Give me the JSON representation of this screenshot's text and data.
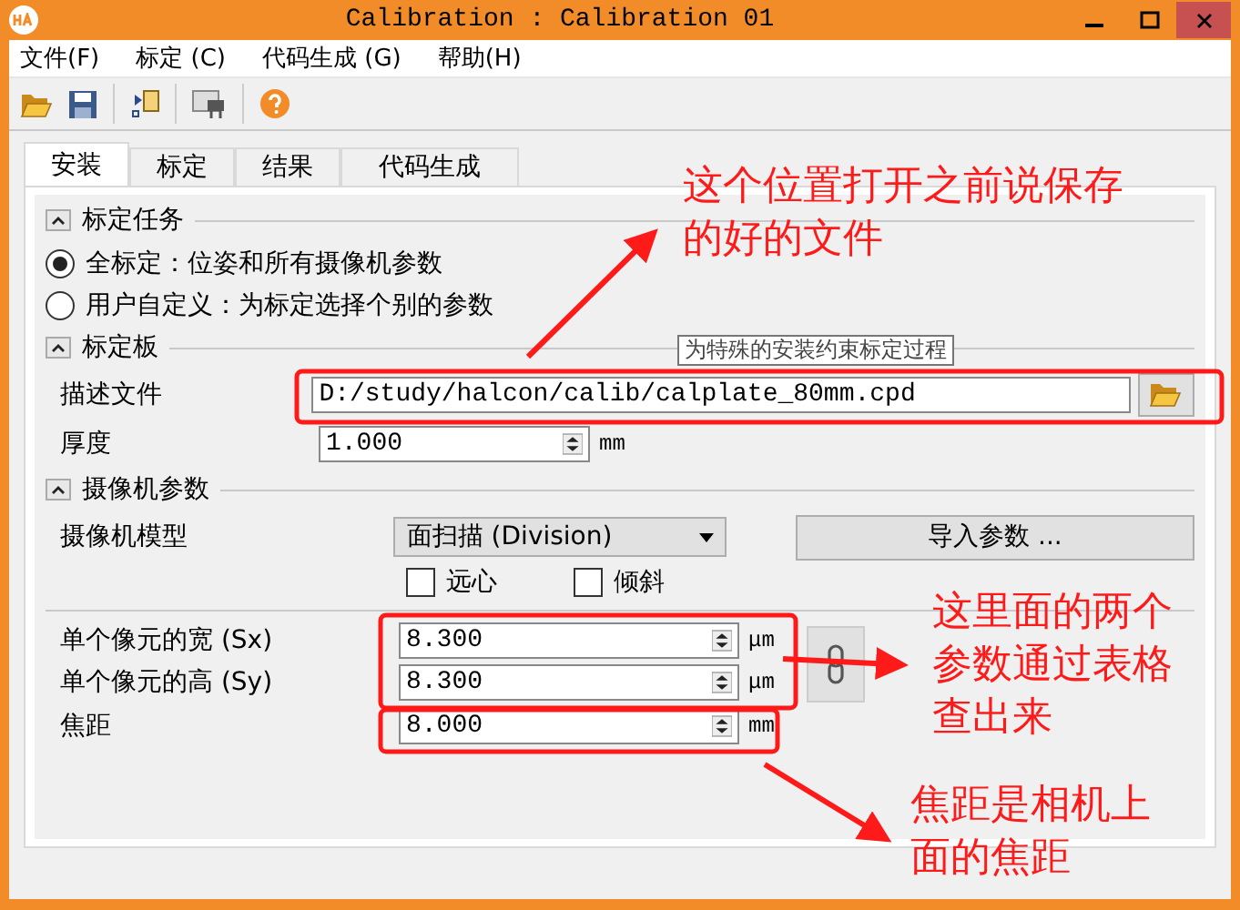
{
  "window": {
    "title": "Calibration : Calibration 01"
  },
  "menu": [
    {
      "label": "文件(F)"
    },
    {
      "label": "标定 (C)"
    },
    {
      "label": "代码生成 (G)"
    },
    {
      "label": "帮助(H)"
    }
  ],
  "tabs": [
    {
      "label": "安装",
      "selected": true
    },
    {
      "label": "标定",
      "selected": false
    },
    {
      "label": "结果",
      "selected": false
    },
    {
      "label": "代码生成",
      "selected": false
    }
  ],
  "task": {
    "title": "标定任务",
    "expanded": true,
    "options": [
      {
        "label": "全标定：位姿和所有摄像机参数",
        "selected": true
      },
      {
        "label": "用户自定义：为标定选择个别的参数",
        "selected": false
      }
    ]
  },
  "plate": {
    "title": "标定板",
    "expanded": true,
    "file_label": "描述文件",
    "file_value": "D:/study/halcon/calib/calplate_80mm.cpd",
    "thickness_label": "厚度",
    "thickness_value": "1.000",
    "thickness_unit": "mm"
  },
  "camera": {
    "title": "摄像机参数",
    "expanded": true,
    "model_label": "摄像机模型",
    "model_value": "面扫描 (Division)",
    "import_button": "导入参数 ...",
    "options": [
      {
        "label": "远心",
        "checked": false
      },
      {
        "label": "倾斜",
        "checked": false
      }
    ],
    "params": [
      {
        "label": "单个像元的宽 (Sx)",
        "value": "8.300",
        "unit": "μm"
      },
      {
        "label": "单个像元的高 (Sy)",
        "value": "8.300",
        "unit": "μm"
      },
      {
        "label": "焦距",
        "value": "8.000",
        "unit": "mm"
      }
    ]
  },
  "tooltip": "为特殊的安装约束标定过程",
  "annotations": [
    {
      "lines": [
        "这个位置打开之前说保存",
        "的好的文件"
      ]
    },
    {
      "lines": [
        "这里面的两个",
        "参数通过表格",
        "查出来"
      ]
    },
    {
      "lines": [
        "焦距是相机上",
        "面的焦距"
      ]
    }
  ]
}
